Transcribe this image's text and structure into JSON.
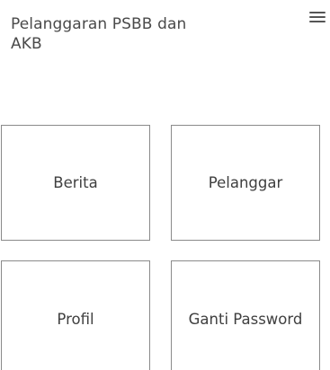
{
  "header": {
    "title": "Pelanggaran PSBB dan AKB",
    "menu_icon": "hamburger-menu-icon"
  },
  "tiles": [
    {
      "label": "Berita"
    },
    {
      "label": "Pelanggar"
    },
    {
      "label": "Profil"
    },
    {
      "label": "Ganti Password"
    }
  ],
  "colors": {
    "text": "#444444",
    "border": "#8a8a8a",
    "background": "#ffffff"
  }
}
